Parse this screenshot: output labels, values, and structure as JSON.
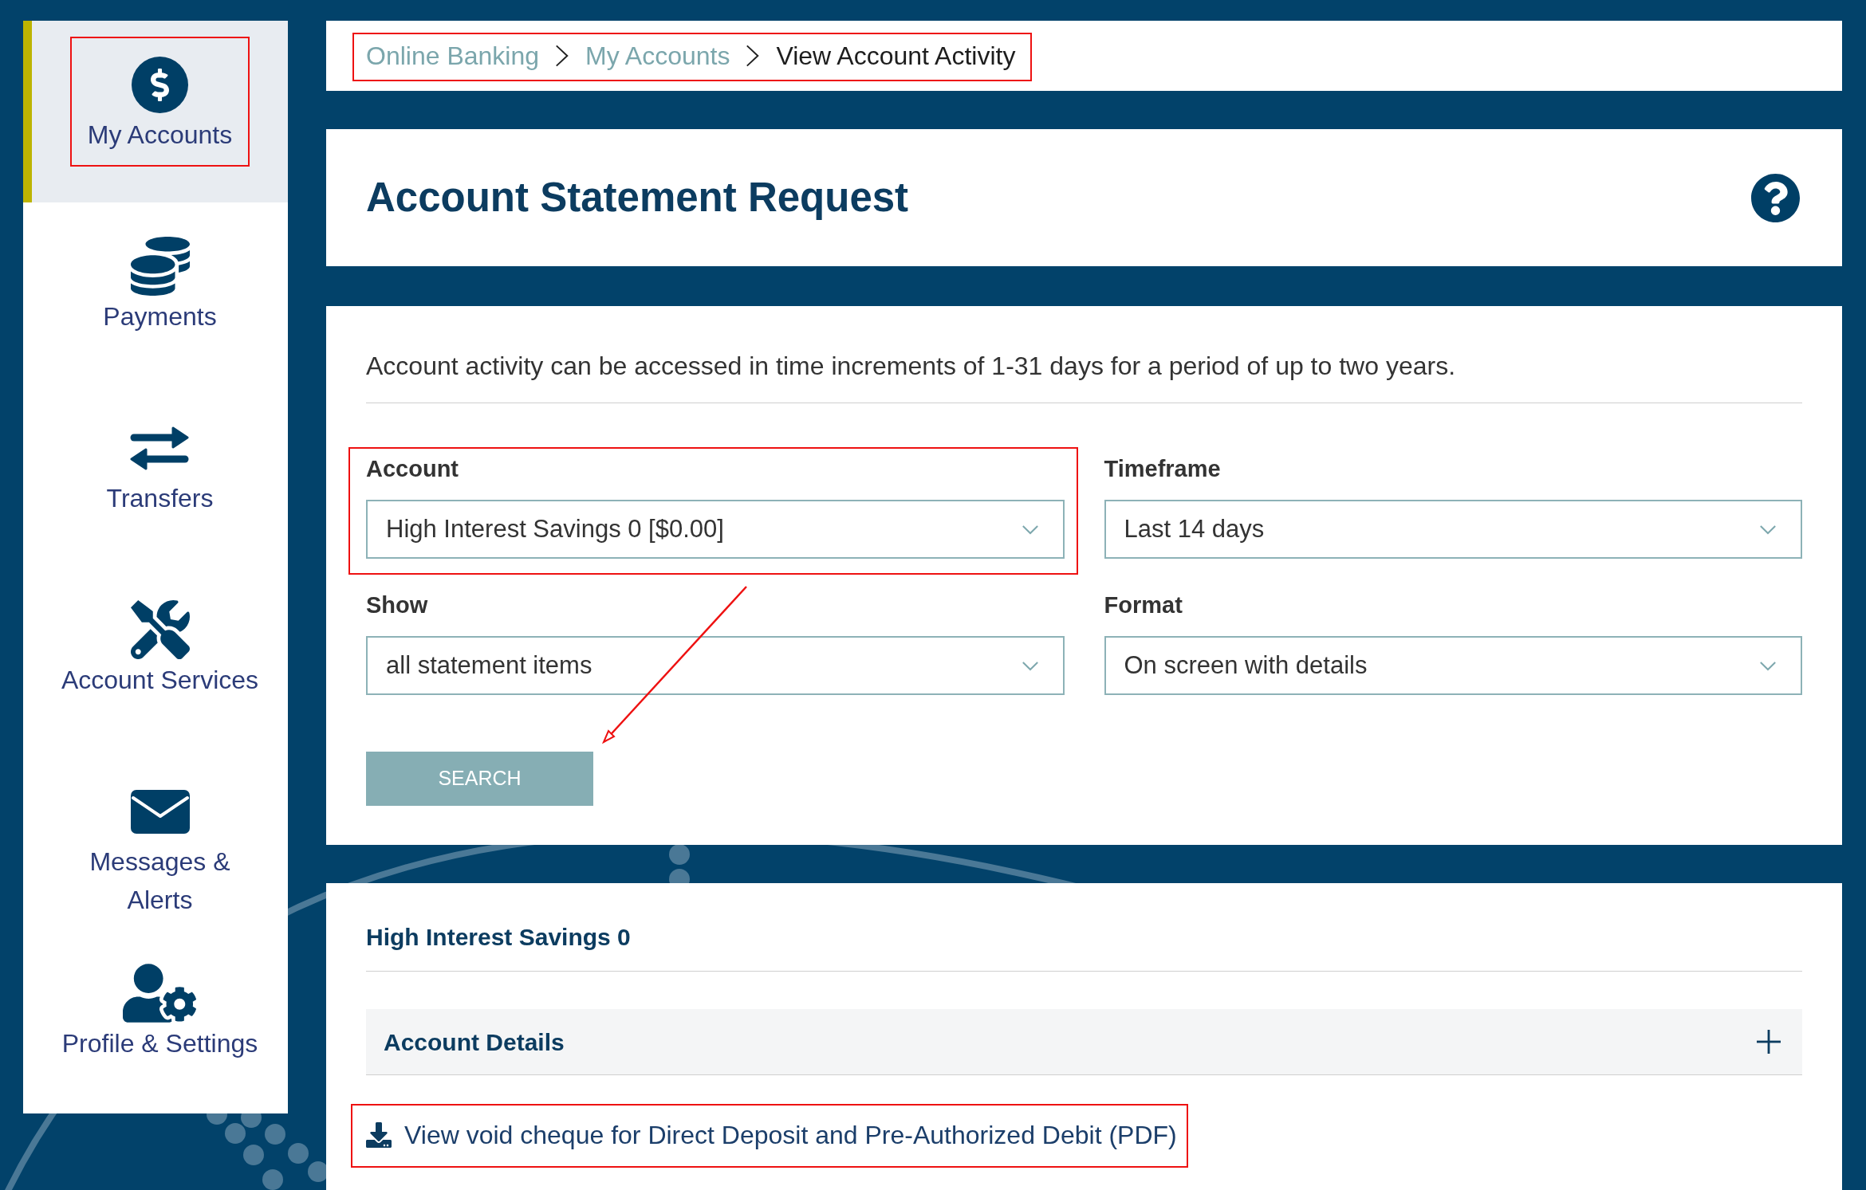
{
  "sidebar": {
    "items": [
      {
        "label": "My Accounts",
        "selected": true,
        "highlighted": true
      },
      {
        "label": "Payments",
        "selected": false,
        "highlighted": false
      },
      {
        "label": "Transfers",
        "selected": false,
        "highlighted": false
      },
      {
        "label": "Account Services",
        "selected": false,
        "highlighted": false
      },
      {
        "label": "Messages & Alerts",
        "selected": false,
        "highlighted": false
      },
      {
        "label": "Profile & Settings",
        "selected": false,
        "highlighted": false
      }
    ]
  },
  "breadcrumb": {
    "highlighted": true,
    "items": [
      {
        "label": "Online Banking",
        "current": false
      },
      {
        "label": "My Accounts",
        "current": false
      },
      {
        "label": "View Account Activity",
        "current": true
      }
    ]
  },
  "page_title": "Account Statement Request",
  "form": {
    "intro": "Account activity can be accessed in time increments of 1-31 days for a period of up to two years.",
    "fields": [
      {
        "label": "Account",
        "value": "High Interest Savings 0 [$0.00]",
        "highlighted": true
      },
      {
        "label": "Timeframe",
        "value": "Last 14 days",
        "highlighted": false
      },
      {
        "label": "Show",
        "value": "all statement items",
        "highlighted": false
      },
      {
        "label": "Format",
        "value": "On screen with details",
        "highlighted": false
      }
    ],
    "search_button": "SEARCH",
    "annotation_arrow": true
  },
  "results": {
    "account_name": "High Interest Savings 0",
    "accordion": {
      "label": "Account Details",
      "expanded": false
    },
    "link": {
      "label": "View void cheque for Direct Deposit and Pre-Authorized Debit (PDF)",
      "highlighted": true
    }
  }
}
